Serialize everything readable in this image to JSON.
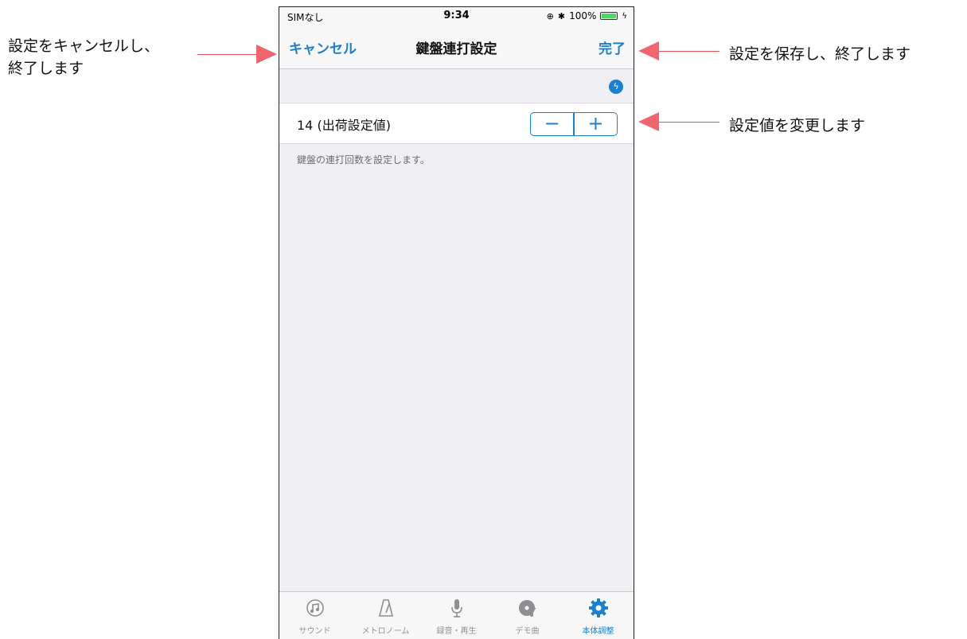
{
  "annotations": {
    "cancel_note_line1": "設定をキャンセルし、",
    "cancel_note_line2": "終了します",
    "done_note": "設定を保存し、終了します",
    "stepper_note": "設定値を変更します"
  },
  "status_bar": {
    "carrier": "SIMなし",
    "time": "9:34",
    "battery": "100%",
    "battery_level": 1.0
  },
  "nav": {
    "cancel_label": "キャンセル",
    "title": "鍵盤連打設定",
    "done_label": "完了"
  },
  "setting": {
    "value_text": "14 (出荷設定値)",
    "minus_label": "−",
    "plus_label": "+",
    "description": "鍵盤の連打回数を設定します。"
  },
  "tabs": [
    {
      "label": "サウンド",
      "icon": "sound-icon",
      "active": false
    },
    {
      "label": "メトロノーム",
      "icon": "metronome-icon",
      "active": false
    },
    {
      "label": "録音・再生",
      "icon": "microphone-icon",
      "active": false
    },
    {
      "label": "デモ曲",
      "icon": "demo-disc-icon",
      "active": false
    },
    {
      "label": "本体調整",
      "icon": "gear-icon",
      "active": true
    }
  ],
  "colors": {
    "accent": "#1b7fcf",
    "arrow": "#f2646e"
  }
}
